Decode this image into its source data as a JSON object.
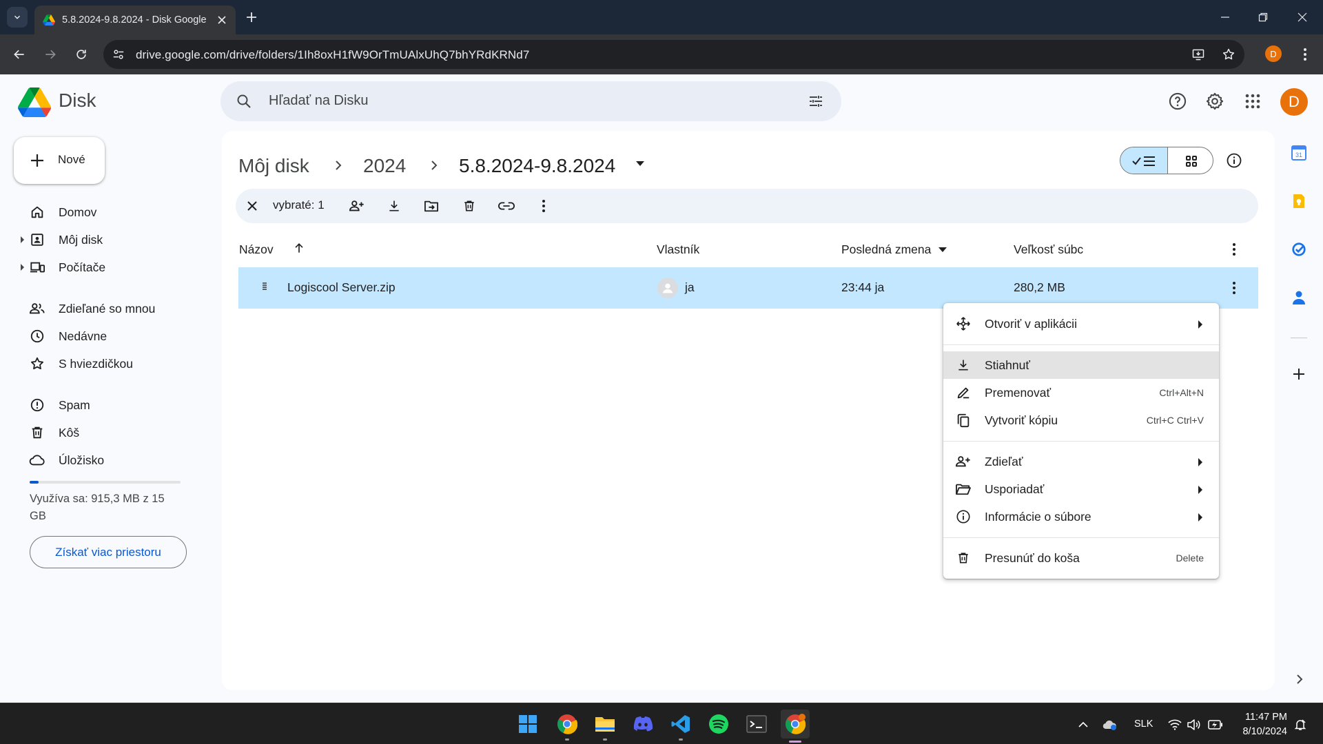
{
  "browser": {
    "tab_title": "5.8.2024-9.8.2024 - Disk Google",
    "url": "drive.google.com/drive/folders/1Ih8oxH1fW9OrTmUAlxUhQ7bhYRdKRNd7",
    "profile_initial": "D",
    "icons": [
      "tab-list-icon",
      "drive-favicon-icon",
      "tab-close-icon",
      "new-tab-icon",
      "minimize-icon",
      "maximize-icon",
      "window-close-icon",
      "back-icon",
      "forward-icon",
      "reload-icon",
      "site-info-icon",
      "install-app-icon",
      "bookmark-star-icon"
    ]
  },
  "app": {
    "name": "Disk",
    "search_placeholder": "Hľadať na Disku",
    "avatar_initial": "D",
    "accent_color": "#0b57d0",
    "selected_row_color": "#c2e7ff",
    "icons": [
      "drive-logo",
      "search-icon",
      "search-options-icon",
      "help-icon",
      "settings-icon",
      "apps-grid-icon"
    ]
  },
  "sidebar": {
    "new_label": "Nové",
    "items": [
      {
        "label": "Domov",
        "icon": "home-icon"
      },
      {
        "label": "Môj disk",
        "icon": "my-drive-icon"
      },
      {
        "label": "Počítače",
        "icon": "computers-icon"
      },
      {
        "label": "Zdieľané so mnou",
        "icon": "shared-icon"
      },
      {
        "label": "Nedávne",
        "icon": "clock-icon"
      },
      {
        "label": "S hviezdičkou",
        "icon": "star-icon"
      },
      {
        "label": "Spam",
        "icon": "spam-icon"
      },
      {
        "label": "Kôš",
        "icon": "trash-icon"
      },
      {
        "label": "Úložisko",
        "icon": "cloud-icon"
      }
    ],
    "storage_fraction": 0.06,
    "storage_text": "Využíva sa: 915,3 MB z 15 GB",
    "get_storage_label": "Získať viac priestoru"
  },
  "breadcrumb": [
    "Môj disk",
    "2024",
    "5.8.2024-9.8.2024"
  ],
  "selection_bar": {
    "count_label": "vybraté: 1",
    "actions": [
      "clear-selection-icon",
      "share-icon",
      "download-icon",
      "move-icon",
      "trash-icon",
      "link-icon",
      "more-vert-icon"
    ]
  },
  "table": {
    "columns": [
      "Názov",
      "Vlastník",
      "Posledná zmena",
      "Veľkosť súbc"
    ],
    "rows": [
      {
        "name": "Logiscool Server.zip",
        "owner": "ja",
        "modified": "23:44 ja",
        "size": "280,2 MB",
        "icon": "zip-file-icon"
      }
    ]
  },
  "context_menu": {
    "items": [
      {
        "label": "Otvoriť v aplikácii",
        "shortcut": "",
        "submenu": true,
        "icon": "open-with-icon"
      },
      {
        "label": "Stiahnuť",
        "shortcut": "",
        "submenu": false,
        "icon": "download-icon"
      },
      {
        "label": "Premenovať",
        "shortcut": "Ctrl+Alt+N",
        "submenu": false,
        "icon": "rename-icon"
      },
      {
        "label": "Vytvoriť kópiu",
        "shortcut": "Ctrl+C Ctrl+V",
        "submenu": false,
        "icon": "copy-icon"
      },
      {
        "label": "Zdieľať",
        "shortcut": "",
        "submenu": true,
        "icon": "share-icon"
      },
      {
        "label": "Usporiadať",
        "shortcut": "",
        "submenu": true,
        "icon": "organize-icon"
      },
      {
        "label": "Informácie o súbore",
        "shortcut": "",
        "submenu": true,
        "icon": "info-icon"
      },
      {
        "label": "Presunúť do koša",
        "shortcut": "Delete",
        "submenu": false,
        "icon": "trash-icon"
      }
    ],
    "highlighted": "Stiahnuť"
  },
  "right_rail": [
    "calendar-icon",
    "keep-icon",
    "tasks-icon",
    "contacts-icon",
    "add-addon-icon"
  ],
  "taskbar": {
    "apps": [
      "windows-start-icon",
      "chrome-icon",
      "file-explorer-icon",
      "discord-icon",
      "vscode-icon",
      "spotify-icon",
      "terminal-icon",
      "chrome-profile-icon"
    ],
    "language": "SLK",
    "time": "11:47 PM",
    "date": "8/10/2024"
  }
}
